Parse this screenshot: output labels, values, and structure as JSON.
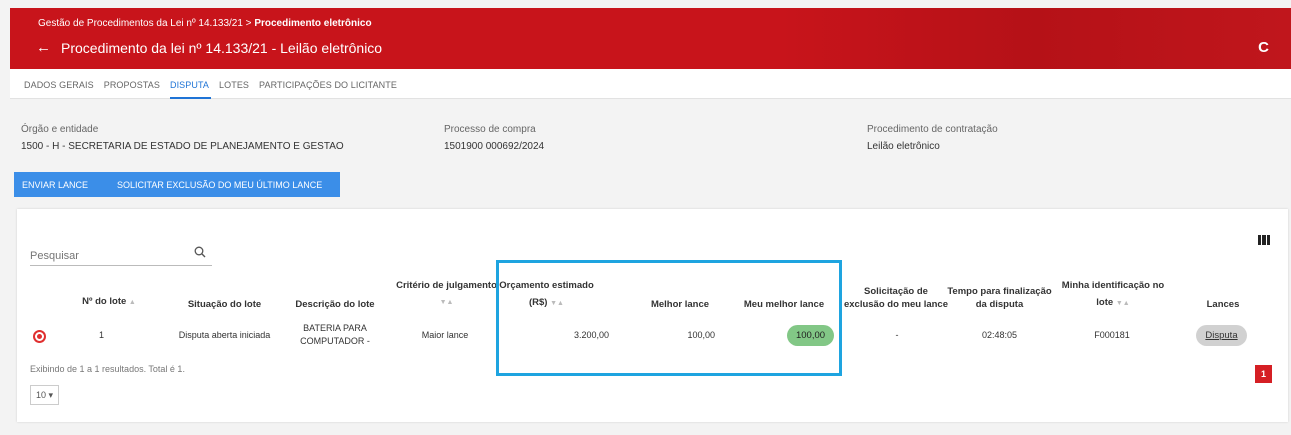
{
  "header": {
    "breadcrumb_prefix": "Gestão de Procedimentos da Lei nº 14.133/21 >",
    "breadcrumb_current": "Procedimento eletrônico",
    "back_glyph": "←",
    "title": "Procedimento da lei nº 14.133/21 - Leilão eletrônico",
    "refresh_glyph": "C",
    "brand_color": "#c8141b"
  },
  "tabs": [
    {
      "label": "DADOS GERAIS",
      "active": false
    },
    {
      "label": "PROPOSTAS",
      "active": false
    },
    {
      "label": "DISPUTA",
      "active": true
    },
    {
      "label": "LOTES",
      "active": false
    },
    {
      "label": "PARTICIPAÇÕES DO LICITANTE",
      "active": false
    }
  ],
  "info": {
    "orgao_label": "Órgão e entidade",
    "orgao_value": "1500 - H - SECRETARIA DE ESTADO DE PLANEJAMENTO E GESTAO",
    "processo_label": "Processo de compra",
    "processo_value": "1501900 000692/2024",
    "procedimento_label": "Procedimento de contratação",
    "procedimento_value": "Leilão eletrônico"
  },
  "actions": {
    "send_bid": "ENVIAR LANCE",
    "request_delete": "SOLICITAR EXCLUSÃO DO MEU ÚLTIMO LANCE"
  },
  "table": {
    "search_placeholder": "Pesquisar",
    "columns_icon": "columns-icon",
    "headers": {
      "lote": "Nº do lote",
      "situacao": "Situação do lote",
      "descricao": "Descrição do lote",
      "criterio": "Critério de julgamento",
      "orcamento_1": "Orçamento estimado",
      "orcamento_2": "(R$)",
      "melhor": "Melhor lance",
      "meu_melhor": "Meu melhor lance",
      "solicitacao_1": "Solicitação de",
      "solicitacao_2": "exclusão do meu lance",
      "tempo_1": "Tempo para finalização",
      "tempo_2": "da disputa",
      "ident_1": "Minha identificação no",
      "ident_2": "lote",
      "lances": "Lances"
    },
    "sort_glyph": "▼▲",
    "sort_up_glyph": "▲",
    "rows": [
      {
        "lote": "1",
        "situacao": "Disputa aberta iniciada",
        "descricao_1": "BATERIA PARA",
        "descricao_2": "COMPUTADOR -",
        "criterio": "Maior lance",
        "orcamento": "3.200,00",
        "melhor": "100,00",
        "meu_melhor": "100,00",
        "solicitacao": "-",
        "tempo": "02:48:05",
        "ident": "F000181",
        "lances": "Disputa"
      }
    ],
    "footer_text": "Exibindo de 1 a 1 resultados. Total é 1.",
    "page_size": "10 ▾",
    "current_page": "1"
  },
  "colors": {
    "accent_blue": "#3b8ee8",
    "highlight_box": "#1ea4e0",
    "bid_green": "#82c786",
    "page_red": "#d51f24"
  }
}
